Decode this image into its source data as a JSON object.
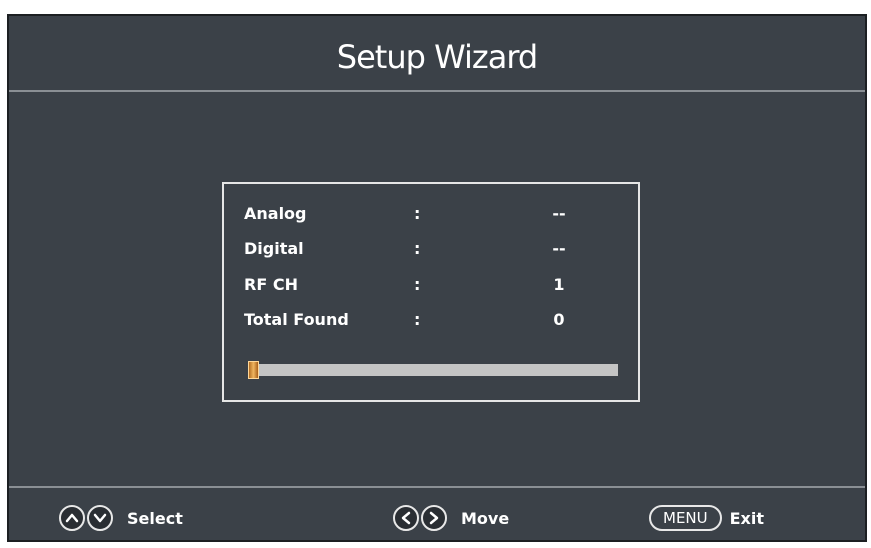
{
  "window": {
    "title": "Setup Wizard"
  },
  "scan": {
    "rows": [
      {
        "label": "Analog",
        "colon": ":",
        "value": "--"
      },
      {
        "label": "Digital",
        "colon": ":",
        "value": "--"
      },
      {
        "label": "RF CH",
        "colon": ":",
        "value": "1"
      },
      {
        "label": "Total Found",
        "colon": ":",
        "value": "0"
      }
    ],
    "progress_percent": 3
  },
  "footer": {
    "select_label": "Select",
    "move_label": "Move",
    "menu_key": "MENU",
    "exit_label": "Exit"
  },
  "icons": {
    "select": [
      "up-arrow-icon",
      "down-arrow-icon"
    ],
    "move": [
      "left-arrow-icon",
      "right-arrow-icon"
    ]
  },
  "colors": {
    "background": "#3b4148",
    "progress_fill": "#e0a050",
    "progress_track": "#c4c4c4"
  }
}
